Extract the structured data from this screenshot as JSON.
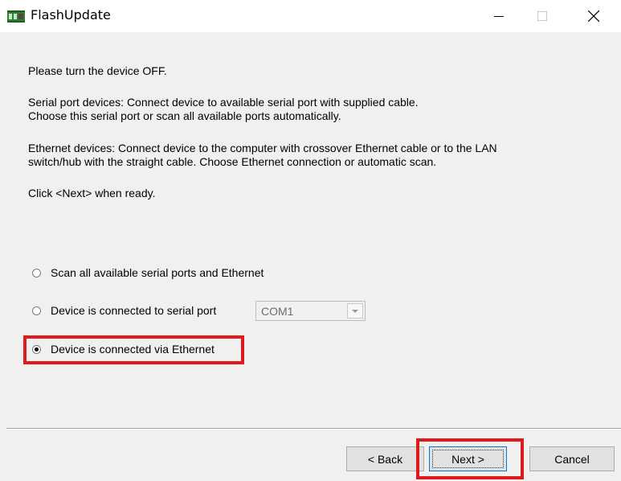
{
  "window": {
    "title": "FlashUpdate",
    "app_icon": "flash-chip-icon",
    "controls": [
      "minimize-icon",
      "maximize-icon",
      "close-icon"
    ]
  },
  "instructions": {
    "line1": "Please turn the device OFF.",
    "serial_line1": "Serial port devices: Connect device to available serial port with supplied cable.",
    "serial_line2": "Choose this serial port or scan all available ports automatically.",
    "ethernet_line1": "Ethernet devices: Connect device to the computer with crossover Ethernet cable or to the LAN",
    "ethernet_line2": "switch/hub with the straight cable. Choose Ethernet connection or automatic scan.",
    "ready": "Click <Next> when ready."
  },
  "options": [
    {
      "label": "Scan all available serial ports and Ethernet",
      "checked": false
    },
    {
      "label": "Device is connected to serial port",
      "checked": false
    },
    {
      "label": "Device is connected via Ethernet",
      "checked": true
    }
  ],
  "serial_port": {
    "selected": "COM1",
    "enabled": false
  },
  "buttons": {
    "back": "< Back",
    "next": "Next >",
    "cancel": "Cancel"
  },
  "colors": {
    "highlight": "#e0191c",
    "dialog_bg": "#f0f0f0",
    "button_bg": "#e1e1e1",
    "focus_border": "#0078d7"
  }
}
